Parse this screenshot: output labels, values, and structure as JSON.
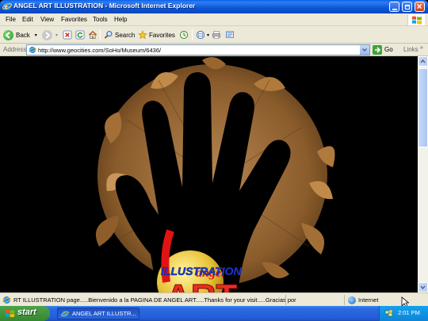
{
  "window": {
    "title": "ANGEL ART ILLUSTRATION - Microsoft Internet Explorer"
  },
  "menubar": {
    "items": [
      "File",
      "Edit",
      "View",
      "Favorites",
      "Tools",
      "Help"
    ]
  },
  "toolbar": {
    "back_label": "Back",
    "search_label": "Search",
    "favorites_label": "Favorites"
  },
  "address": {
    "label": "Address",
    "url": "http://www.geocities.com/SoHo/Museum/6436/",
    "go_label": "Go",
    "links_label": "Links"
  },
  "page": {
    "logo_art": "ART",
    "logo_illustration": "ILLUSTRATION",
    "logo_script": "angel"
  },
  "status": {
    "text": "RT ILLUSTRATION page.....Bienvenido a la PAGINA DE ANGEL ART.....Thanks for your visit.....Gracias por",
    "zone": "Internet"
  },
  "taskbar": {
    "start_label": "start",
    "task_label": "ANGEL ART ILLUSTR...",
    "clock": "2:01 PM"
  },
  "colors": {
    "titlebar": "#0b56d4",
    "chrome": "#ece9d8",
    "taskbar": "#245cd8",
    "start": "#3c9a37",
    "logo_red": "#e01313",
    "logo_blue": "#1c3ed8",
    "leaf_brown": "#b07a3c"
  }
}
